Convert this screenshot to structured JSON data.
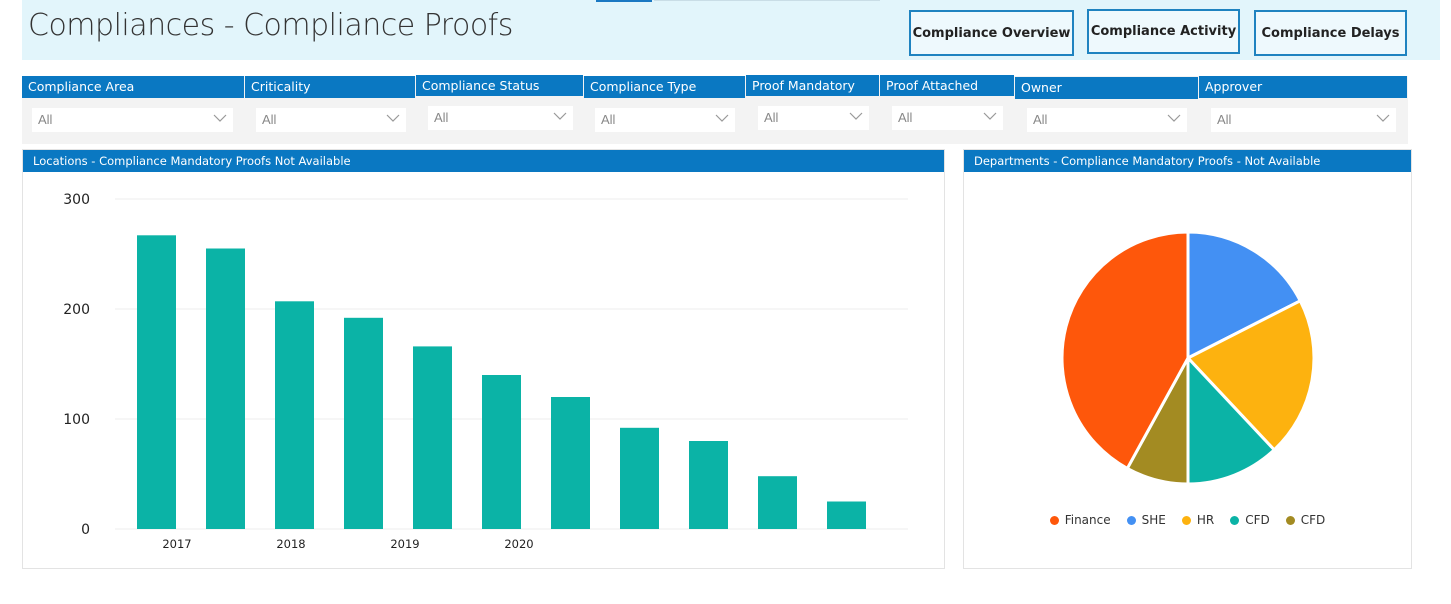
{
  "header": {
    "title": "Compliances - Compliance Proofs",
    "nav_buttons": [
      {
        "label": "Compliance Overview"
      },
      {
        "label": "Compliance Activity"
      },
      {
        "label": "Compliance Delays"
      }
    ]
  },
  "filters": [
    {
      "label": "Compliance Area",
      "value": "All"
    },
    {
      "label": "Criticality",
      "value": "All"
    },
    {
      "label": "Compliance Status",
      "value": "All"
    },
    {
      "label": "Compliance Type",
      "value": "All"
    },
    {
      "label": "Proof Mandatory",
      "value": "All"
    },
    {
      "label": "Proof Attached",
      "value": "All"
    },
    {
      "label": "Owner",
      "value": "All"
    },
    {
      "label": "Approver",
      "value": "All"
    }
  ],
  "colors": {
    "accent": "#0a78c2",
    "bar": "#0bb3a6",
    "header_bg": "#e2f5fb"
  },
  "chart_data": [
    {
      "type": "bar",
      "title": "Locations - Compliance Mandatory Proofs Not Available",
      "xlabel": "",
      "ylabel": "",
      "x_tick_labels": [
        "2017",
        "2018",
        "2019",
        "2020"
      ],
      "values": [
        267,
        255,
        207,
        192,
        166,
        140,
        120,
        92,
        80,
        48,
        25
      ],
      "yticks": [
        0,
        100,
        200,
        300
      ],
      "ylim": [
        0,
        300
      ],
      "grid": true,
      "color": "#0bb3a6"
    },
    {
      "type": "pie",
      "title": "Departments - Compliance Mandatory Proofs - Not Available",
      "legend_position": "bottom",
      "slices": [
        {
          "label": "SHE",
          "value": 17.5,
          "color": "#4390f3"
        },
        {
          "label": "HR",
          "value": 20.5,
          "color": "#fdb20f"
        },
        {
          "label": "CFD",
          "value": 12,
          "color": "#0bb3a6"
        },
        {
          "label": "CFD",
          "value": 8,
          "color": "#a38b22"
        },
        {
          "label": "Finance",
          "value": 42,
          "color": "#fe570b"
        }
      ],
      "legend": [
        {
          "label": "Finance",
          "color": "#fe570b"
        },
        {
          "label": "SHE",
          "color": "#4390f3"
        },
        {
          "label": "HR",
          "color": "#fdb20f"
        },
        {
          "label": "CFD",
          "color": "#0bb3a6"
        },
        {
          "label": "CFD",
          "color": "#a38b22"
        }
      ]
    }
  ]
}
